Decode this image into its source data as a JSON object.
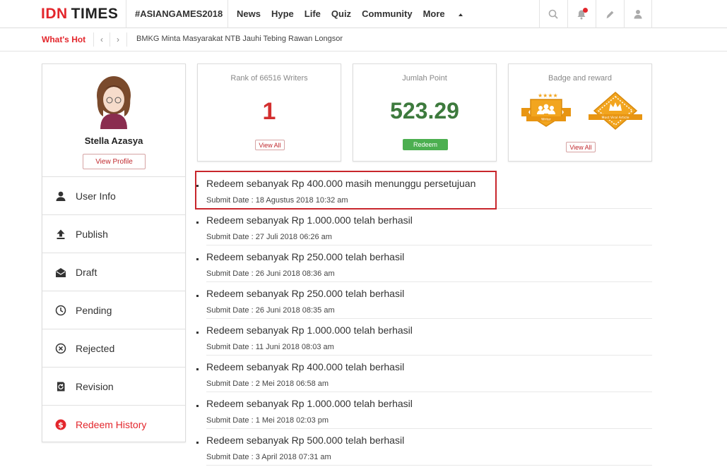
{
  "header": {
    "logo": {
      "idn": "IDN",
      "times": "TIMES"
    },
    "hashtag": "#ASIANGAMES2018",
    "nav": [
      "News",
      "Hype",
      "Life",
      "Quiz",
      "Community",
      "More"
    ],
    "icons": [
      "search-icon",
      "bell-icon",
      "pencil-icon",
      "user-icon"
    ]
  },
  "hot": {
    "label": "What's Hot",
    "headline": "BMKG Minta Masyarakat NTB Jauhi Tebing Rawan Longsor"
  },
  "profile": {
    "name": "Stella Azasya",
    "view_profile": "View Profile"
  },
  "menu": [
    {
      "label": "User Info",
      "icon": "user-icon"
    },
    {
      "label": "Publish",
      "icon": "upload-icon"
    },
    {
      "label": "Draft",
      "icon": "envelope-open-icon"
    },
    {
      "label": "Pending",
      "icon": "clock-icon"
    },
    {
      "label": "Rejected",
      "icon": "x-circle-icon"
    },
    {
      "label": "Revision",
      "icon": "revision-icon"
    },
    {
      "label": "Redeem History",
      "icon": "dollar-circle-icon"
    }
  ],
  "stats": {
    "rank": {
      "title": "Rank of 66516 Writers",
      "value": "1",
      "button": "View All"
    },
    "points": {
      "title": "Jumlah Point",
      "value": "523.29",
      "button": "Redeem"
    },
    "badges": {
      "title": "Badge and reward",
      "button": "View All",
      "badge_labels": [
        "Writer",
        "Most Viral Article"
      ]
    }
  },
  "redeem_history": [
    {
      "title": "Redeem sebanyak Rp 400.000 masih menunggu persetujuan",
      "date": "Submit Date : 18 Agustus 2018 10:32 am",
      "highlighted": true
    },
    {
      "title": "Redeem sebanyak Rp 1.000.000 telah berhasil",
      "date": "Submit Date : 27 Juli 2018 06:26 am"
    },
    {
      "title": "Redeem sebanyak Rp 250.000 telah berhasil",
      "date": "Submit Date : 26 Juni 2018 08:36 am"
    },
    {
      "title": "Redeem sebanyak Rp 250.000 telah berhasil",
      "date": "Submit Date : 26 Juni 2018 08:35 am"
    },
    {
      "title": "Redeem sebanyak Rp 1.000.000 telah berhasil",
      "date": "Submit Date : 11 Juni 2018 08:03 am"
    },
    {
      "title": "Redeem sebanyak Rp 400.000 telah berhasil",
      "date": "Submit Date : 2 Mei 2018 06:58 am"
    },
    {
      "title": "Redeem sebanyak Rp 1.000.000 telah berhasil",
      "date": "Submit Date : 1 Mei 2018 02:03 pm"
    },
    {
      "title": "Redeem sebanyak Rp 500.000 telah berhasil",
      "date": "Submit Date : 3 April 2018 07:31 am"
    }
  ],
  "colors": {
    "brand_red": "#e3262c",
    "point_green": "#3d7a3d",
    "redeem_button": "#4caf50",
    "badge_gold": "#f2a51f",
    "highlight_border": "#c8262c"
  }
}
